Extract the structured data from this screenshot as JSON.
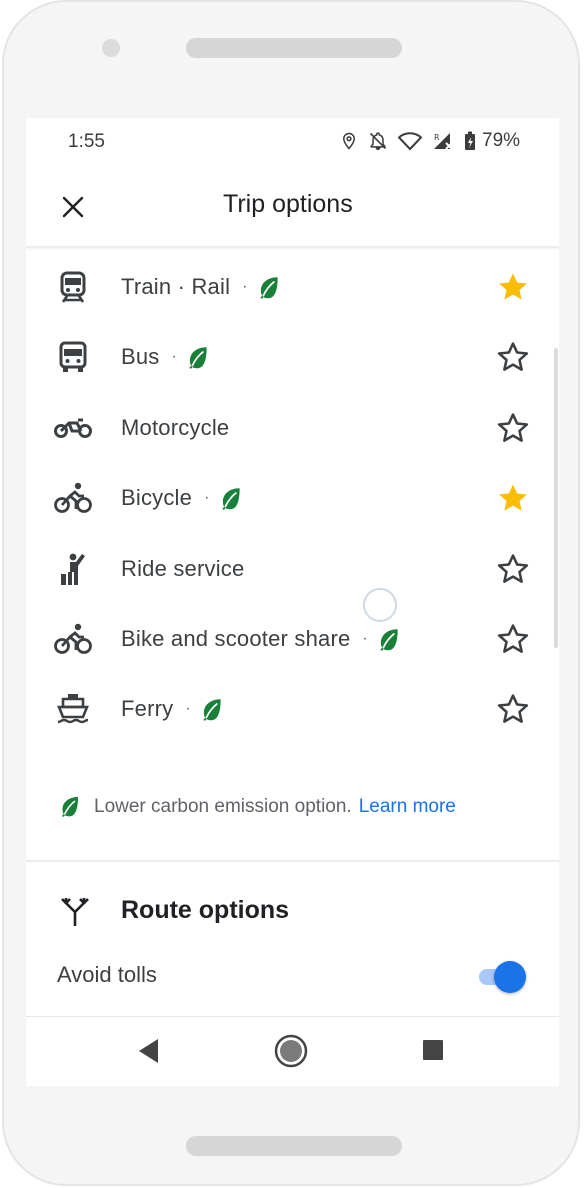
{
  "status_bar": {
    "time": "1:55",
    "battery": "79%",
    "icons": [
      "location-icon",
      "notifications-off-icon",
      "wifi-icon",
      "signal-roaming-icon",
      "battery-icon"
    ]
  },
  "app_bar": {
    "title": "Trip options",
    "close_icon": "close-icon"
  },
  "options": [
    {
      "label": "Train · Rail",
      "icon": "train-icon",
      "eco": true,
      "starred": true
    },
    {
      "label": "Bus",
      "icon": "bus-icon",
      "eco": true,
      "starred": false
    },
    {
      "label": "Motorcycle",
      "icon": "motorcycle-icon",
      "eco": false,
      "starred": false
    },
    {
      "label": "Bicycle",
      "icon": "bicycle-icon",
      "eco": true,
      "starred": true
    },
    {
      "label": "Ride service",
      "icon": "ride-service-icon",
      "eco": false,
      "starred": false
    },
    {
      "label": "Bike and scooter share",
      "icon": "bike-share-icon",
      "eco": true,
      "starred": false
    },
    {
      "label": "Ferry",
      "icon": "ferry-icon",
      "eco": true,
      "starred": false
    }
  ],
  "separator": "·",
  "footnote": {
    "text": "Lower carbon emission option.",
    "link": "Learn more"
  },
  "route_options": {
    "title": "Route options",
    "avoid_tolls": {
      "label": "Avoid tolls",
      "enabled": true
    }
  },
  "colors": {
    "accent": "#1a73e8",
    "star_filled": "#fbbc04",
    "leaf": "#188038",
    "text": "#3c4043"
  }
}
